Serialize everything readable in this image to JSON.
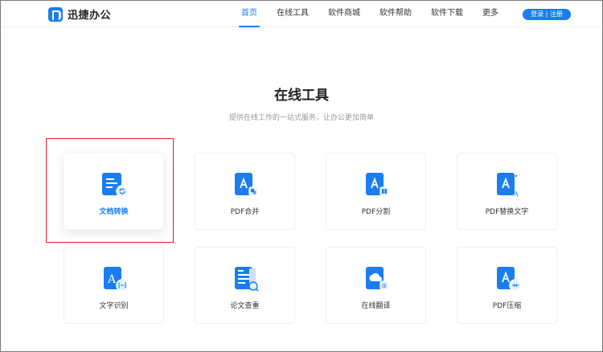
{
  "header": {
    "logo_text": "迅捷办公",
    "nav": [
      {
        "label": "首页",
        "active": true
      },
      {
        "label": "在线工具",
        "active": false
      },
      {
        "label": "软件商城",
        "active": false
      },
      {
        "label": "软件帮助",
        "active": false
      },
      {
        "label": "软件下载",
        "active": false
      },
      {
        "label": "更多",
        "active": false
      }
    ],
    "login_label": "登录 | 注册"
  },
  "hero": {
    "title": "在线工具",
    "subtitle": "提供在线工作的一站式服务，让办公更加简单"
  },
  "tools": [
    {
      "label": "文档转换",
      "icon": "document-convert-icon",
      "selected": true
    },
    {
      "label": "PDF合并",
      "icon": "pdf-merge-icon",
      "selected": false
    },
    {
      "label": "PDF分割",
      "icon": "pdf-split-icon",
      "selected": false
    },
    {
      "label": "PDF替换文字",
      "icon": "pdf-replace-text-icon",
      "selected": false
    },
    {
      "label": "文字识别",
      "icon": "text-recognition-icon",
      "selected": false
    },
    {
      "label": "论文查重",
      "icon": "paper-check-icon",
      "selected": false
    },
    {
      "label": "在线翻译",
      "icon": "online-translate-icon",
      "selected": false
    },
    {
      "label": "PDF压缩",
      "icon": "pdf-compress-icon",
      "selected": false
    }
  ],
  "colors": {
    "accent": "#1a7df0",
    "highlight_border": "#e02020"
  }
}
